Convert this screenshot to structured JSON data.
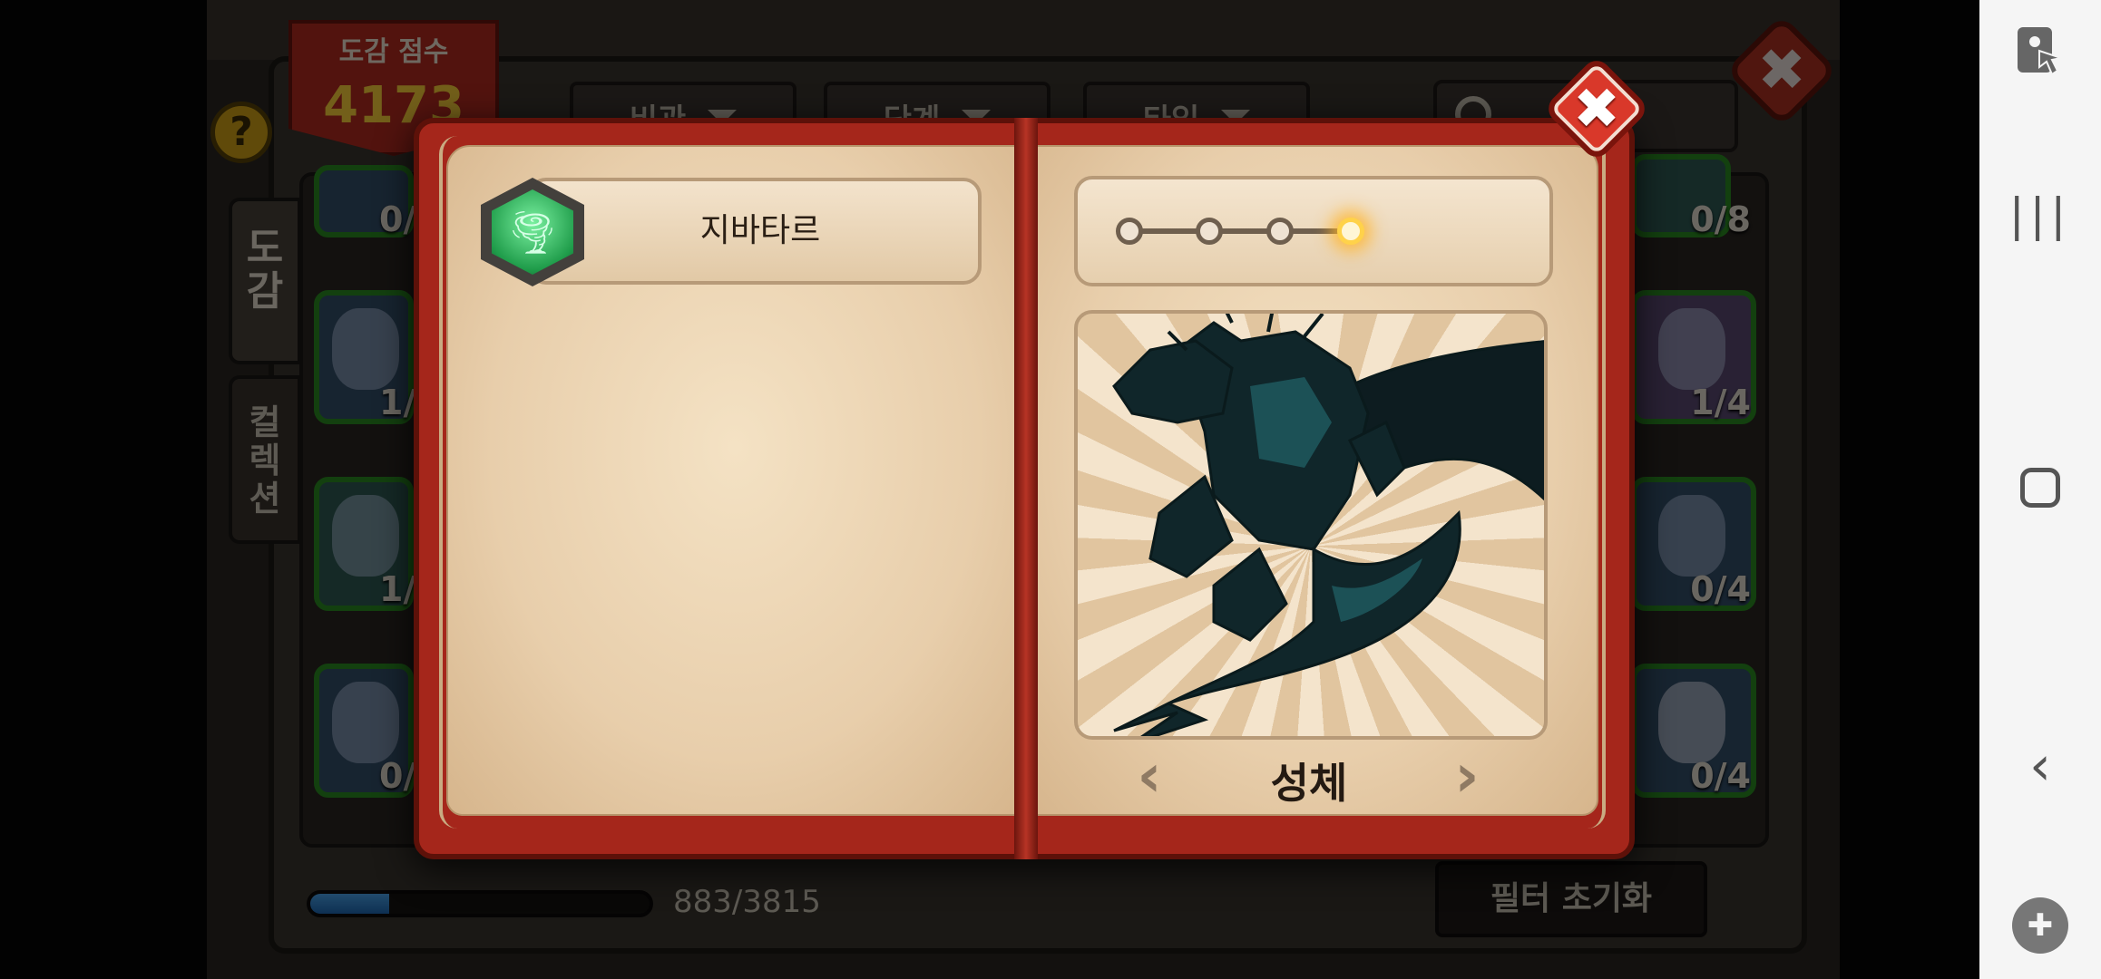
{
  "background_panel": {
    "score_label": "도감 점수",
    "score_value": "4173",
    "help_label": "?",
    "dropdowns": [
      "비관",
      "단계",
      "타입"
    ],
    "tabs": [
      {
        "label": "도\n감",
        "active": true
      },
      {
        "label": "컬\n렉\n션",
        "active": false
      }
    ],
    "left_cards": [
      {
        "count": "0/"
      },
      {
        "count": "1/"
      },
      {
        "count": "1/"
      },
      {
        "count": "0/"
      }
    ],
    "right_cards": [
      {
        "count": "0/8"
      },
      {
        "count": "1/4"
      },
      {
        "count": "0/4"
      },
      {
        "count": "0/4"
      }
    ],
    "progress": {
      "text": "883/3815",
      "current": 883,
      "total": 3815
    },
    "filter_reset_label": "필터 초기화",
    "close_label": "✖"
  },
  "book": {
    "monster_name": "지바타르",
    "element_icon": "wind-tornado-icon",
    "stage_count": 4,
    "stage_active_index": 3,
    "stage_name": "성체",
    "prev_arrow": "‹",
    "next_arrow": "›",
    "close_label": "✖"
  },
  "android_nav": {
    "recent_label": "|||",
    "back_label": "‹",
    "game_tools_label": "✚"
  },
  "colors": {
    "book_red": "#a5261b",
    "page_parchment": "#f4e2c4",
    "progress_blue": "#2f86d6",
    "card_green_border": "#2b8f22",
    "score_gold": "#ffd23a"
  }
}
